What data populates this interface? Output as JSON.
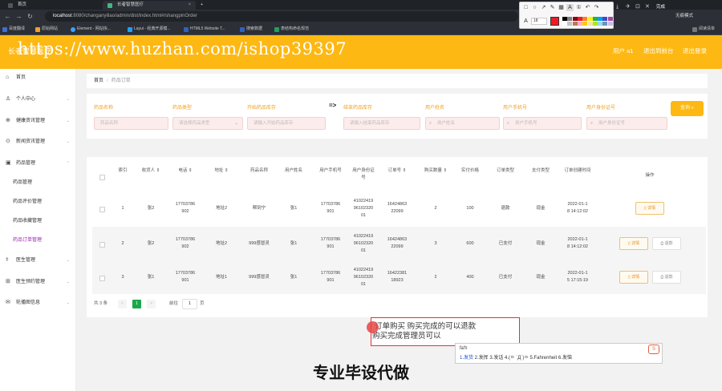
{
  "browser": {
    "tabs": [
      {
        "label": "首页"
      },
      {
        "label": "长者智慧医疗"
      }
    ],
    "new_tab": "+",
    "url_host": "localhost",
    "url_rest": ":8080/changanyiliao/admin/dist/index.html#/shangpinOrder",
    "bookmarks": [
      "百度翻译",
      "原始网站",
      "Element - 网站快...",
      "Layui - 经典开源模...",
      "HTML5 Website T...",
      "搜索数据",
      "表结构命名规范"
    ],
    "right_labels": {
      "mode": "无痕模式",
      "read": "阅读清单",
      "done": "完成"
    }
  },
  "annotation_toolbar": {
    "font_size": "18",
    "colors": [
      "#000000",
      "#7f7f7f",
      "#880015",
      "#ed1c24",
      "#ff7f27",
      "#fff200",
      "#22b14c",
      "#00a2e8",
      "#3f48cc",
      "#a349a4",
      "#ffffff",
      "#c3c3c3",
      "#b97a57",
      "#ffaec9",
      "#ffc90e",
      "#efe4b0",
      "#b5e61d",
      "#99d9ea",
      "#7092be",
      "#c8bfe7"
    ]
  },
  "header": {
    "brand": "长者智慧医疗",
    "links": [
      "用户 a1",
      "退出到前台",
      "退出登录"
    ]
  },
  "watermark": "https://www.huzhan.com/ishop39397",
  "sidebar": {
    "items": [
      {
        "label": "首页",
        "icon": "home-icon"
      },
      {
        "label": "个人中心",
        "icon": "user-icon"
      },
      {
        "label": "健康资讯管理",
        "icon": "health-icon"
      },
      {
        "label": "新闻资讯管理",
        "icon": "news-icon"
      },
      {
        "label": "药品管理",
        "icon": "medicine-icon"
      }
    ],
    "subitems": [
      "药品管理",
      "药品评价管理",
      "药品收藏管理",
      "药品订单管理"
    ],
    "items2": [
      {
        "label": "医生管理",
        "icon": "doctor-icon"
      },
      {
        "label": "医生预约管理",
        "icon": "calendar-icon"
      },
      {
        "label": "轮播图信息",
        "icon": "image-icon"
      }
    ]
  },
  "breadcrumb": {
    "home": "首页",
    "sep": "/",
    "current": "药品订单"
  },
  "filters": [
    {
      "label": "药品名称",
      "placeholder": "药品名称",
      "icon": ""
    },
    {
      "label": "药品类型",
      "placeholder": "请选择药品类型",
      "icon": "select"
    },
    {
      "label": "开始药品库存",
      "placeholder": "请输入开始药品库存",
      "icon": ""
    },
    {
      "label": "结束药品库存",
      "placeholder": "请输入结束药品库存",
      "icon": ""
    },
    {
      "label": "用户姓名",
      "placeholder": "用户姓名",
      "icon": "search"
    },
    {
      "label": "用户手机号",
      "placeholder": "用户手机号",
      "icon": "search"
    },
    {
      "label": "用户身份证号",
      "placeholder": "用户身份证号",
      "icon": "search"
    }
  ],
  "filter_arrow": "=>",
  "search_button": "查询",
  "table": {
    "headers": [
      "索引",
      "收货人",
      "电话",
      "地址",
      "药品名称",
      "用户姓名",
      "用户手机号",
      "用户身份证号",
      "订单号",
      "购买数量",
      "实付价格",
      "订单类型",
      "支付类型",
      "订单创建时间",
      "操作"
    ],
    "rows": [
      {
        "index": "1",
        "receiver": "张2",
        "phone": "17703786\n902",
        "address": "地址2",
        "drug": "帮到宁",
        "user": "张1",
        "mobile": "17703786\n901",
        "idcard": "41022419\n96102320\n01",
        "order": "16424863\n22099",
        "qty": "2",
        "price": "100",
        "otype": "退款",
        "pay": "现金",
        "time": "2022-01-1\n8 14:12:02",
        "actions": [
          "详情"
        ]
      },
      {
        "index": "2",
        "receiver": "张2",
        "phone": "17703786\n902",
        "address": "地址2",
        "drug": "999感冒灵",
        "user": "张1",
        "mobile": "17703786\n901",
        "idcard": "41022419\n96102320\n01",
        "order": "16424863\n22099",
        "qty": "3",
        "price": "600",
        "otype": "已支付",
        "pay": "现金",
        "time": "2022-01-1\n8 14:12:02",
        "actions": [
          "详情",
          "退款"
        ]
      },
      {
        "index": "3",
        "receiver": "张1",
        "phone": "17703786\n901",
        "address": "地址1",
        "drug": "999感冒灵",
        "user": "张1",
        "mobile": "17703786\n901",
        "idcard": "41022419\n96102320\n01",
        "order": "16422381\n18923",
        "qty": "2",
        "price": "400",
        "otype": "已支付",
        "pay": "现金",
        "time": "2022-01-1\n5 17:15:19",
        "actions": [
          "详情",
          "退款"
        ]
      }
    ]
  },
  "pagination": {
    "total": "共 3 条",
    "prev": "<",
    "page": "1",
    "next": ">",
    "goto": "前往",
    "goto_value": "1",
    "unit": "页"
  },
  "note": {
    "line1": "订单购买  购买完成的可以退款",
    "line2": "购买完成管理员可以"
  },
  "ime": {
    "code": "fa'h",
    "candidates": [
      "1.发货",
      "2.发挥",
      "3.发话",
      "4.(ㅇ ˙Д˙)ㅇ",
      "5.Fahrenheit",
      "6.发恼"
    ],
    "logo": "S"
  },
  "caption": "专业毕设代做"
}
